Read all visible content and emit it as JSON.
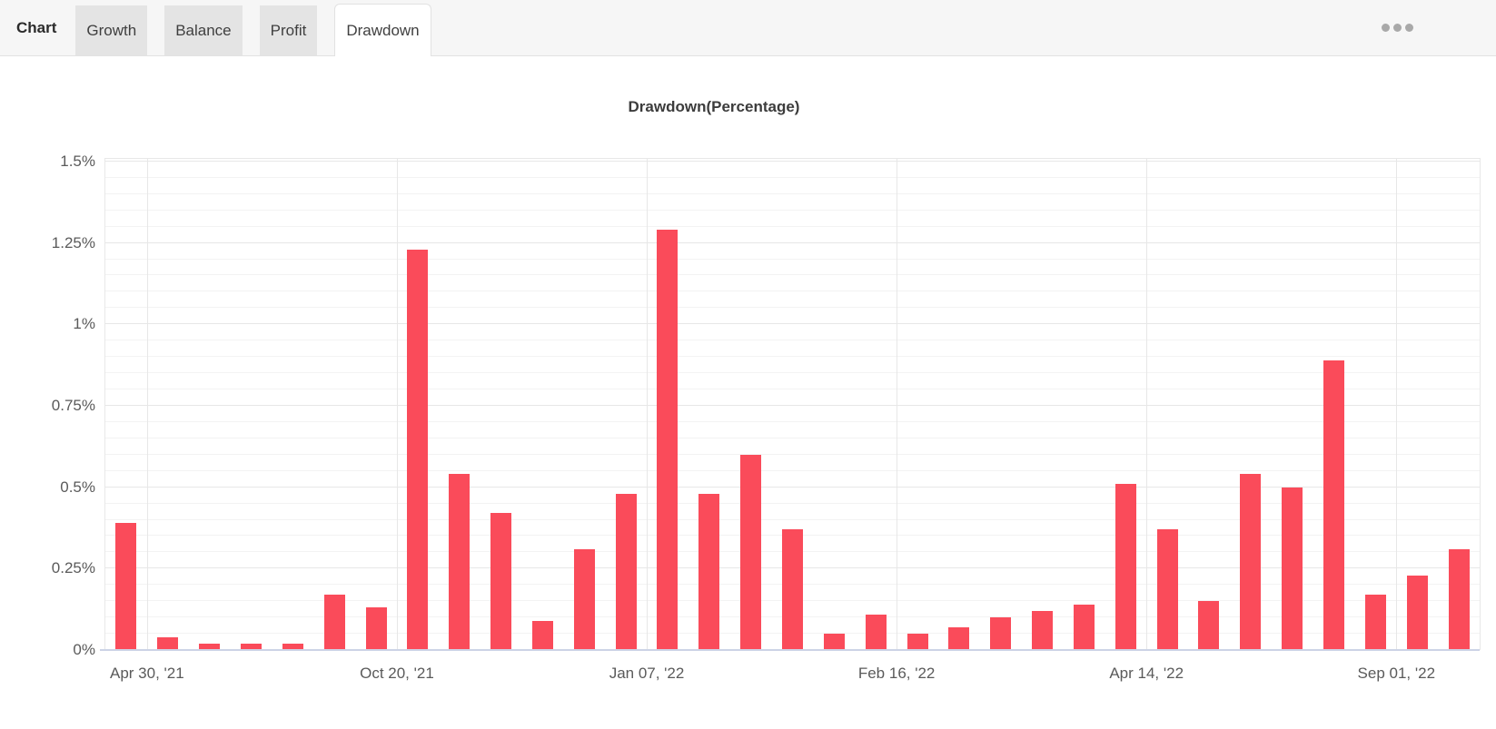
{
  "tabbar": {
    "section_label": "Chart",
    "tabs": [
      {
        "label": "Growth",
        "active": false
      },
      {
        "label": "Balance",
        "active": false
      },
      {
        "label": "Profit",
        "active": false
      },
      {
        "label": "Drawdown",
        "active": true
      }
    ],
    "menu_icon": "ellipsis-icon"
  },
  "chart_data": {
    "type": "bar",
    "title": "Drawdown(Percentage)",
    "unit": "%",
    "bar_color": "#fa4b5a",
    "grid": true,
    "legend": "none",
    "ylim": [
      0,
      1.508
    ],
    "minor_grid_step": 0.05,
    "yticks": [
      {
        "value": 0,
        "label": "0%"
      },
      {
        "value": 0.25,
        "label": "0.25%"
      },
      {
        "value": 0.5,
        "label": "0.5%"
      },
      {
        "value": 0.75,
        "label": "0.75%"
      },
      {
        "value": 1,
        "label": "1%"
      },
      {
        "value": 1.25,
        "label": "1.25%"
      },
      {
        "value": 1.5,
        "label": "1.5%"
      }
    ],
    "xticks": [
      {
        "label": "Apr 30, '21",
        "band_boundary": 1
      },
      {
        "label": "Oct 20, '21",
        "band_boundary": 7
      },
      {
        "label": "Jan 07, '22",
        "band_boundary": 13
      },
      {
        "label": "Feb 16, '22",
        "band_boundary": 19
      },
      {
        "label": "Apr 14, '22",
        "band_boundary": 25
      },
      {
        "label": "Sep 01, '22",
        "band_boundary": 31
      }
    ],
    "values": [
      0.39,
      0.04,
      0.02,
      0.02,
      0.02,
      0.17,
      0.13,
      1.23,
      0.54,
      0.42,
      0.09,
      0.31,
      0.48,
      1.29,
      0.48,
      0.6,
      0.37,
      0.05,
      0.11,
      0.05,
      0.07,
      0.1,
      0.12,
      0.14,
      0.51,
      0.37,
      0.15,
      0.54,
      0.5,
      0.89,
      0.17,
      0.23,
      0.31
    ]
  }
}
